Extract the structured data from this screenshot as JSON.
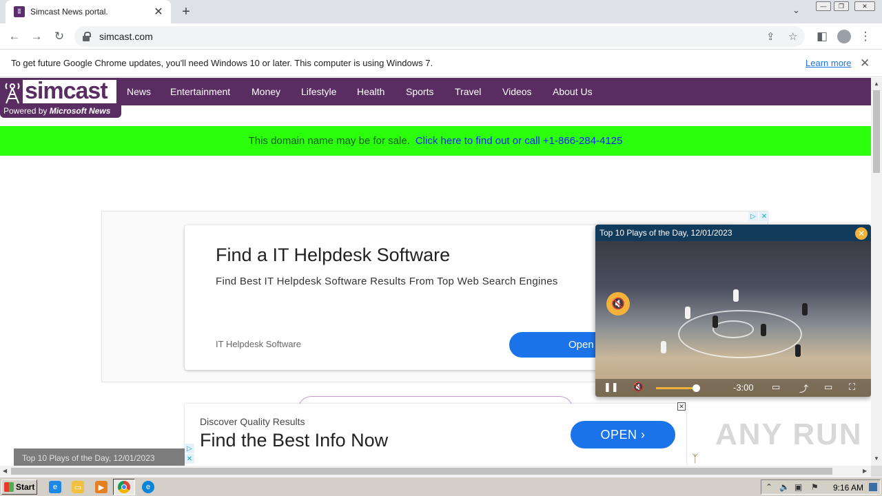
{
  "browser": {
    "tab_title": "Simcast News portal.",
    "tab_favicon": "simcast-favicon",
    "new_tab_symbol": "+",
    "tab_search_symbol": "⌄",
    "url": "simcast.com",
    "infobar_text": "To get future Google Chrome updates, you'll need Windows 10 or later. This computer is using Windows 7.",
    "infobar_link": "Learn more"
  },
  "site": {
    "logo_text": "simcast",
    "powered_prefix": "Powered by ",
    "powered_brand": "Microsoft News",
    "nav": [
      "News",
      "Entertainment",
      "Money",
      "Lifestyle",
      "Health",
      "Sports",
      "Travel",
      "Videos",
      "About Us"
    ],
    "sale_text": "This domain name may be for sale.",
    "sale_link": "Click here to find out or call +1-866-284-4125",
    "sale_bar_color": "#2bff0c",
    "brand_color": "#5a2d62"
  },
  "ad_main": {
    "title": "Find a IT Helpdesk Software",
    "subtitle": "Find Best IT Helpdesk Software Results From Top Web Search Engines",
    "brand": "IT Helpdesk Software",
    "button": "Open"
  },
  "ad_bottom": {
    "subtitle": "Discover Quality Results",
    "title": "Find the Best Info Now",
    "button": "OPEN"
  },
  "mini_player": {
    "title": "Top 10 Plays of the Day, 12/01/2023"
  },
  "video": {
    "title": "Top 10 Plays of the Day, 12/01/2023",
    "time": "-3:00",
    "progress_fraction": 0.32
  },
  "watermark": "ANY RUN",
  "taskbar": {
    "start_label": "Start",
    "clock": "9:16 AM"
  }
}
